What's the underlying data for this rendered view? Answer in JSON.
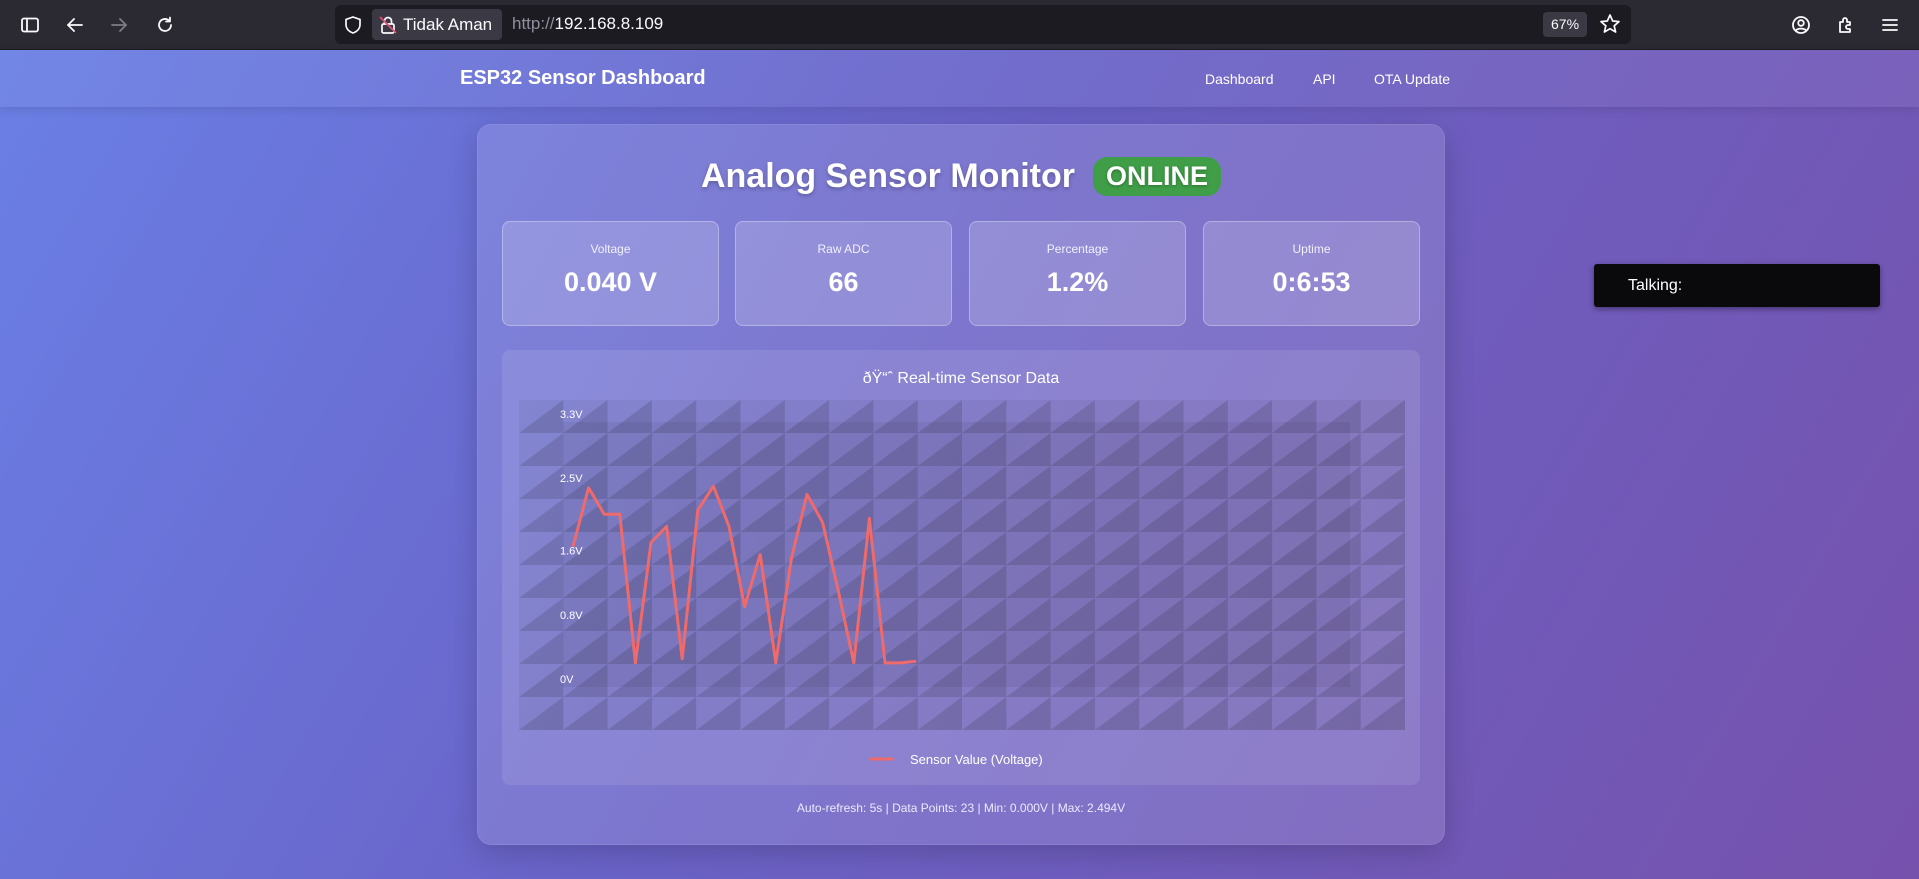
{
  "browser": {
    "security_label": "Tidak Aman",
    "url_protocol": "http://",
    "url_host": "192.168.8.109",
    "zoom": "67%"
  },
  "nav": {
    "title": "ESP32 Sensor Dashboard",
    "links": [
      "Dashboard",
      "API",
      "OTA Update"
    ]
  },
  "main": {
    "heading": "Analog Sensor Monitor",
    "status": "ONLINE",
    "status_color": "#3f9e47",
    "stats": [
      {
        "label": "Voltage",
        "value": "0.040 V"
      },
      {
        "label": "Raw ADC",
        "value": "66"
      },
      {
        "label": "Percentage",
        "value": "1.2%"
      },
      {
        "label": "Uptime",
        "value": "0:6:53"
      }
    ],
    "footer": "Auto-refresh: 5s | Data Points: 23 | Min: 0.000V | Max: 2.494V"
  },
  "chart_data": {
    "type": "line",
    "title": "ðŸ“ˆ Real-time Sensor Data",
    "y_tick_labels": [
      "0V",
      "0.8V",
      "1.6V",
      "2.5V",
      "3.3V"
    ],
    "y_ticks": [
      0,
      0.8,
      1.6,
      2.5,
      3.3
    ],
    "ylim": [
      0,
      3.3
    ],
    "grid": true,
    "legend_position": "bottom",
    "series": [
      {
        "name": "Sensor Value (Voltage)",
        "color": "#ef6a6a",
        "values": [
          1.75,
          2.48,
          2.15,
          2.15,
          0.3,
          1.8,
          2.0,
          0.35,
          2.2,
          2.5,
          2.0,
          1.0,
          1.65,
          0.3,
          1.6,
          2.4,
          2.05,
          1.2,
          0.3,
          2.1,
          0.3,
          0.3,
          0.32
        ]
      }
    ]
  },
  "overlay": {
    "talking_label": "Talking:"
  }
}
